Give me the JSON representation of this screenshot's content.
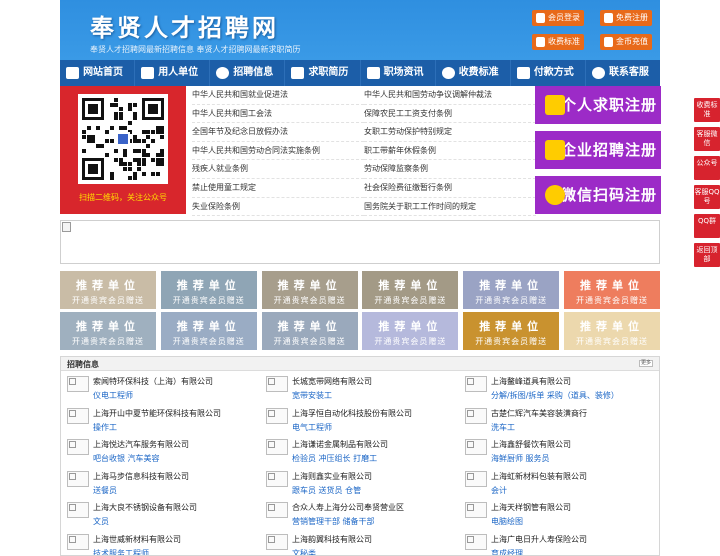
{
  "header": {
    "title": "奉贤人才招聘网",
    "slogan": "奉贤人才招聘网最新招聘信息   奉贤人才招聘网最新求职简历",
    "buttons": {
      "member_login": "会员登录",
      "free_register": "免费注册",
      "fee_standard": "收费标准",
      "coin_recharge": "金币充值"
    }
  },
  "nav": [
    "网站首页",
    "用人单位",
    "招聘信息",
    "求职简历",
    "职场资讯",
    "收费标准",
    "付款方式",
    "联系客服"
  ],
  "notice": {
    "qr_caption": "扫描二维码，关注公众号",
    "left_links": [
      "中华人民共和国就业促进法",
      "中华人民共和国工会法",
      "全国年节及纪念日放假办法",
      "中华人民共和国劳动合同法实施条例",
      "残疾人就业条例",
      "禁止使用童工规定",
      "失业保险条例"
    ],
    "right_links": [
      "中华人民共和国劳动争议调解仲裁法",
      "保障农民工工资支付条例",
      "女职工劳动保护特别规定",
      "职工带薪年休假条例",
      "劳动保障监察条例",
      "社会保险费征缴暂行条例",
      "国务院关于职工工作时间的规定"
    ],
    "register": [
      "个人求职注册",
      "企业招聘注册",
      "微信扫码注册"
    ]
  },
  "recommend": {
    "title": "推荐单位",
    "subtitle": "开通贵宾会员赠送",
    "colors": [
      "#c9bca6",
      "#8fa5b5",
      "#a79e8c",
      "#a39a86",
      "#9aa3c4",
      "#ee7d5e",
      "#9fb0bf",
      "#9aacc4",
      "#9aa9bc",
      "#b5b9dc",
      "#c9922f",
      "#ecd8ad"
    ]
  },
  "jobs": {
    "title": "招聘信息",
    "more": "更多",
    "items": [
      {
        "company": "索闻特环保科技（上海）有限公司",
        "positions": "仪电工程师"
      },
      {
        "company": "长城宽带网络有限公司",
        "positions": "宽带安装工"
      },
      {
        "company": "上海鳌峰道具有限公司",
        "positions": "分解/拆图/拆单 采购（道具、装修）"
      },
      {
        "company": "上海开山中夏节能环保科技有限公司",
        "positions": "操作工"
      },
      {
        "company": "上海孚恒自动化科技股份有限公司",
        "positions": "电气工程师"
      },
      {
        "company": "古楚仁辉汽车美容装潢商行",
        "positions": "洗车工"
      },
      {
        "company": "上海悦达汽车服务有限公司",
        "positions": "吧台收银 汽车美容"
      },
      {
        "company": "上海谦诺金属制品有限公司",
        "positions": "检验员 冲压组长 打磨工"
      },
      {
        "company": "上海鑫舒餐饮有限公司",
        "positions": "海鲜厨师 服务员"
      },
      {
        "company": "上海马步信息科技有限公司",
        "positions": "送餐员"
      },
      {
        "company": "上海则鑫实业有限公司",
        "positions": "跟车员 送货员 仓管"
      },
      {
        "company": "上海虹新材料包装有限公司",
        "positions": "会计"
      },
      {
        "company": "上海大良不锈钢设备有限公司",
        "positions": "文员"
      },
      {
        "company": "合众人寿上海分公司奉贤营业区",
        "positions": "营销管理干部 储备干部"
      },
      {
        "company": "上海天样钢管有限公司",
        "positions": "电脑绘图"
      },
      {
        "company": "上海世威新材料有限公司",
        "positions": "技术服务工程师"
      },
      {
        "company": "上海韵翼科技有限公司",
        "positions": "文秘类"
      },
      {
        "company": "上海广电日升人寿保险公司",
        "positions": "育成经理"
      }
    ]
  },
  "sidebar": [
    "收费标准",
    "客服微信",
    "公众号",
    "客服QQ号",
    "QQ群",
    "返回顶部"
  ]
}
